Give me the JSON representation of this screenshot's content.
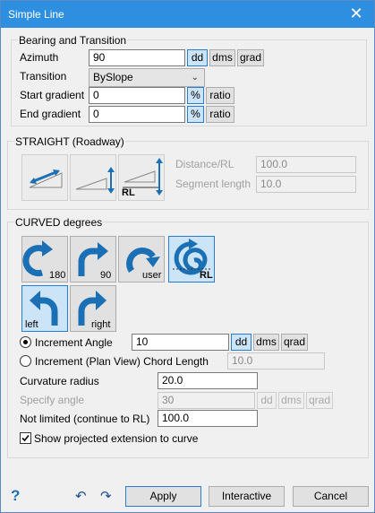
{
  "window": {
    "title": "Simple Line",
    "close_glyph": "✕"
  },
  "bearing": {
    "group_title": "Bearing and Transition",
    "azimuth_label": "Azimuth",
    "azimuth_value": "90",
    "azimuth_units": [
      "dd",
      "dms",
      "grad"
    ],
    "transition_label": "Transition",
    "transition_value": "BySlope",
    "start_gradient_label": "Start gradient",
    "start_gradient_value": "0",
    "end_gradient_label": "End gradient",
    "end_gradient_value": "0",
    "pct_label": "%",
    "ratio_label": "ratio"
  },
  "straight": {
    "group_title": "STRAIGHT (Roadway)",
    "distance_label": "Distance/RL",
    "distance_value": "100.0",
    "segment_label": "Segment length",
    "segment_value": "10.0",
    "rl_caption": "RL"
  },
  "curved": {
    "group_title": "CURVED degrees",
    "captions": {
      "c180": "180",
      "c90": "90",
      "user": "user",
      "rl": "RL",
      "left": "left",
      "right": "right"
    },
    "increment_angle_label": "Increment Angle",
    "increment_angle_value": "10",
    "increment_units": [
      "dd",
      "dms",
      "qrad"
    ],
    "chord_label": "Increment (Plan View) Chord Length",
    "chord_value": "10.0",
    "curvature_label": "Curvature radius",
    "curvature_value": "20.0",
    "specify_label": "Specify angle",
    "specify_value": "30",
    "specify_units": [
      "dd",
      "dms",
      "qrad"
    ],
    "not_limited_label": "Not limited (continue to RL)",
    "not_limited_value": "100.0",
    "show_projected_label": "Show projected extension to curve"
  },
  "footer": {
    "help_glyph": "?",
    "undo_glyph": "↶",
    "redo_glyph": "↷",
    "apply_label": "Apply",
    "interactive_label": "Interactive",
    "cancel_label": "Cancel"
  },
  "colors": {
    "titlebar": "#2e8fe0",
    "selected": "#cce4f7",
    "icon_blue": "#1a6fb5"
  }
}
